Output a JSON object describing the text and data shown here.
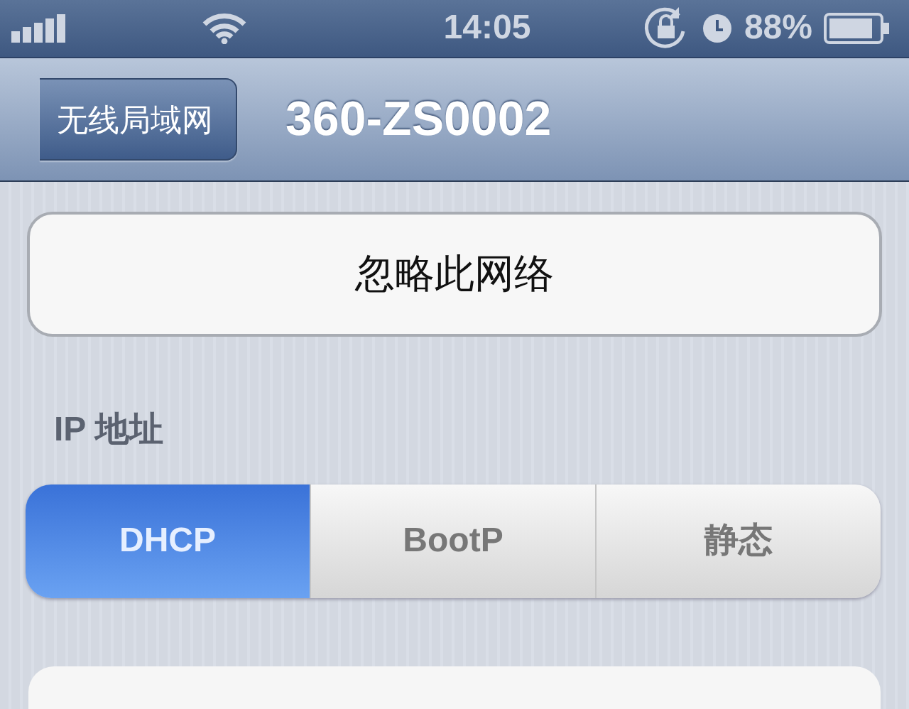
{
  "status_bar": {
    "time": "14:05",
    "battery": "88%"
  },
  "nav_bar": {
    "back": "无线局域网",
    "title": "360-ZS0002"
  },
  "forget_button": "忽略此网络",
  "ip_section": {
    "header": "IP 地址",
    "segments": [
      {
        "label": "DHCP",
        "selected": true
      },
      {
        "label": "BootP",
        "selected": false
      },
      {
        "label": "静态",
        "selected": false
      }
    ]
  }
}
